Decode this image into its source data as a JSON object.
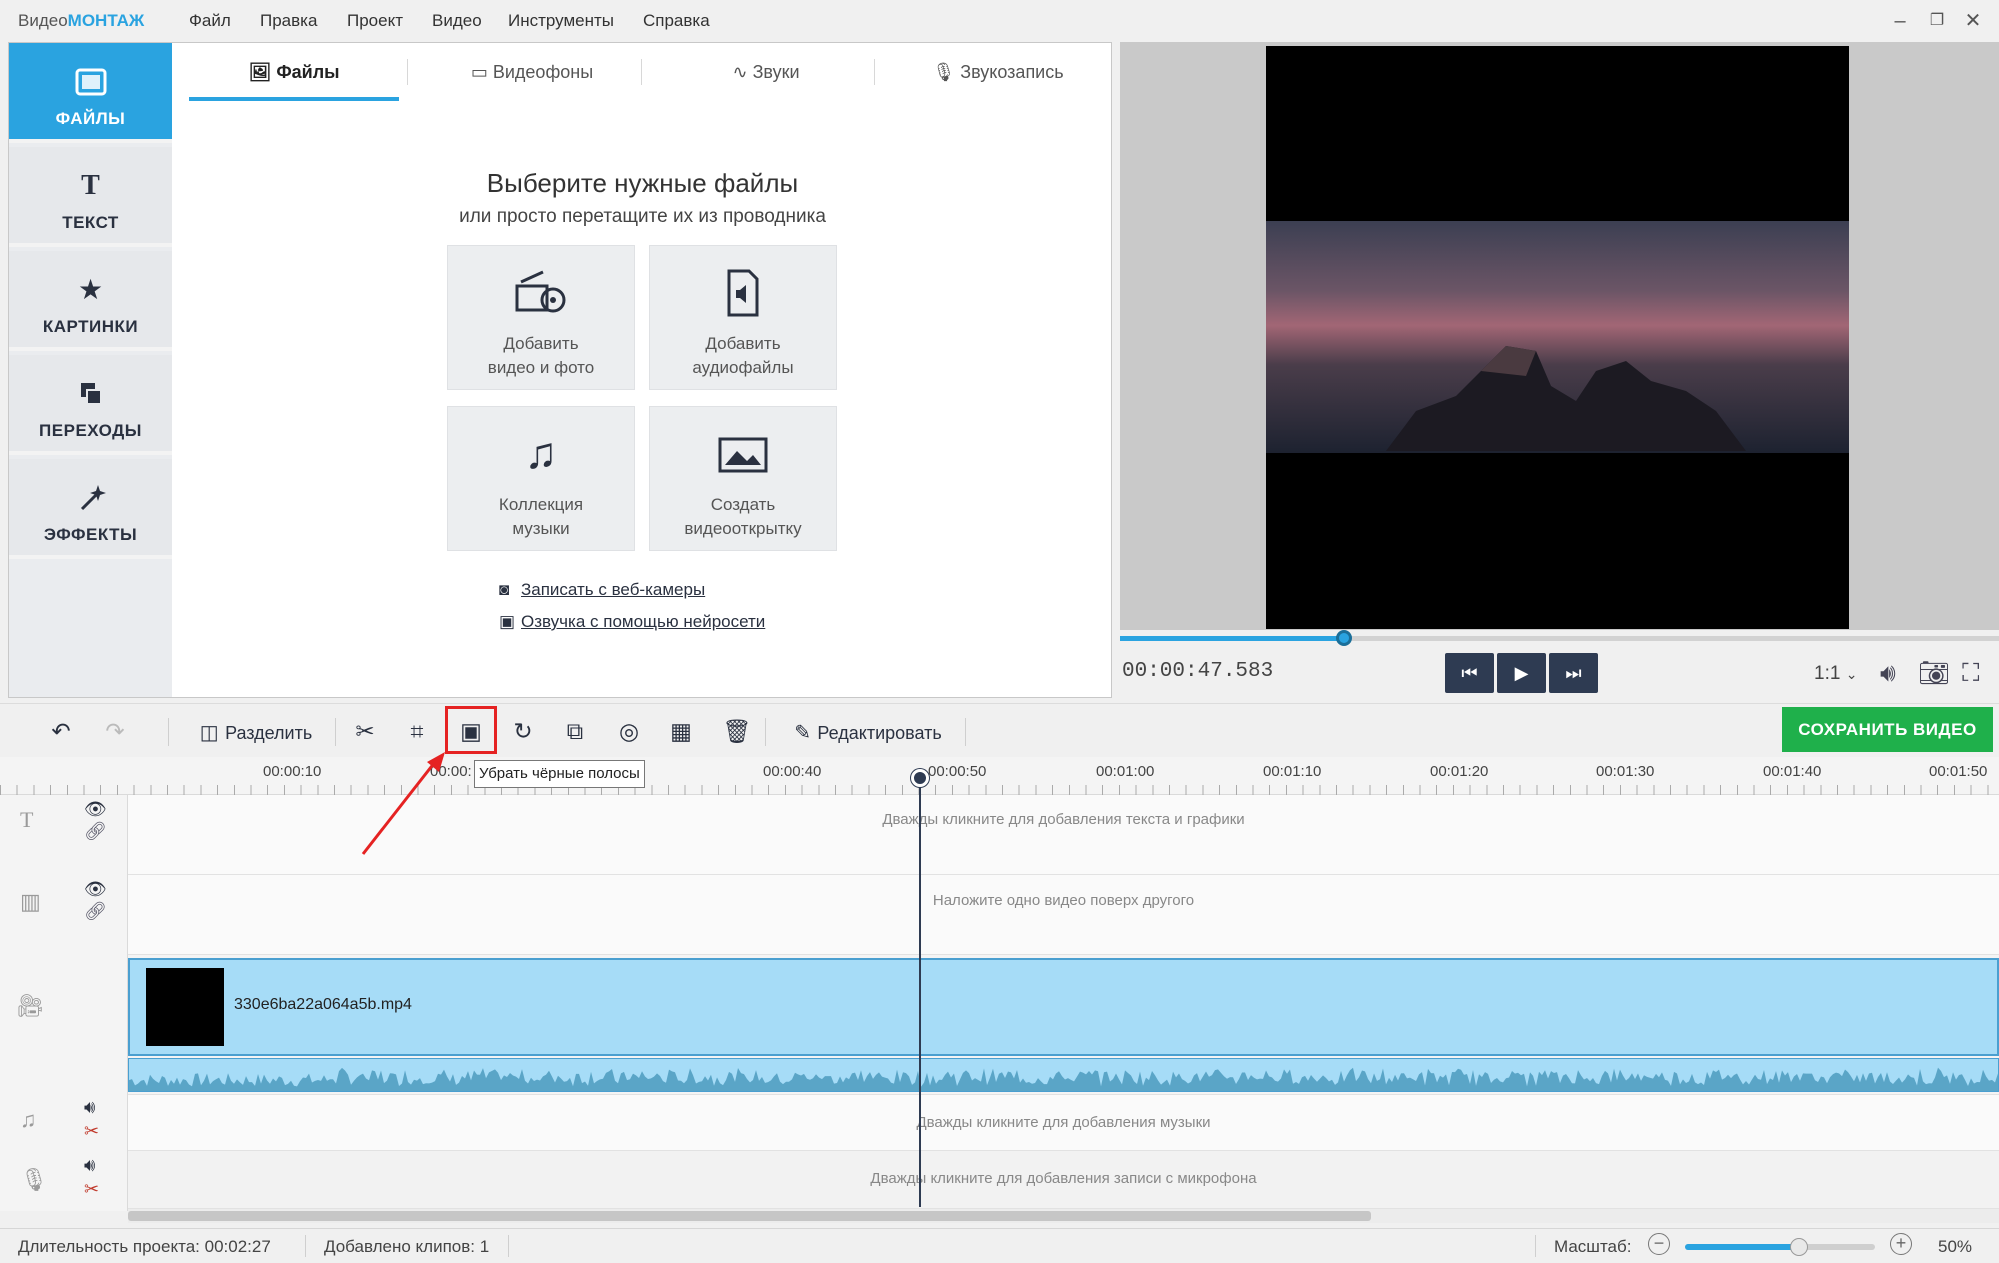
{
  "app": {
    "title_prefix": "Видео",
    "title_brand": "МОНТАЖ"
  },
  "menu": [
    "Файл",
    "Правка",
    "Проект",
    "Видео",
    "Инструменты",
    "Справка"
  ],
  "window_controls": {
    "minimize": "–",
    "restore": "❐",
    "close": "✕"
  },
  "sidebar": [
    {
      "label": "ФАЙЛЫ",
      "icon": "image-icon",
      "active": true
    },
    {
      "label": "ТЕКСТ",
      "icon": "text-icon",
      "active": false
    },
    {
      "label": "КАРТИНКИ",
      "icon": "star-icon",
      "active": false
    },
    {
      "label": "ПЕРЕХОДЫ",
      "icon": "transitions-icon",
      "active": false
    },
    {
      "label": "ЭФФЕКТЫ",
      "icon": "magic-wand-icon",
      "active": false
    }
  ],
  "tabs": [
    {
      "label": "Файлы",
      "icon": "image-icon",
      "active": true
    },
    {
      "label": "Видеофоны",
      "icon": "film-icon",
      "active": false
    },
    {
      "label": "Звуки",
      "icon": "waveform-icon",
      "active": false
    },
    {
      "label": "Звукозапись",
      "icon": "microphone-icon",
      "active": false
    }
  ],
  "files_panel": {
    "heading": "Выберите нужные файлы",
    "subheading": "или просто перетащите их из проводника",
    "tiles": [
      {
        "line1": "Добавить",
        "line2": "видео и фото",
        "icon": "film-camera-icon"
      },
      {
        "line1": "Добавить",
        "line2": "аудиофайлы",
        "icon": "audio-file-icon"
      },
      {
        "line1": "Коллекция",
        "line2": "музыки",
        "icon": "music-notes-icon"
      },
      {
        "line1": "Создать",
        "line2": "видеооткрытку",
        "icon": "postcard-icon"
      }
    ],
    "links": [
      {
        "label": "Записать с веб-камеры",
        "icon": "webcam-icon"
      },
      {
        "label": "Озвучка с помощью нейросети",
        "icon": "ai-voice-icon"
      }
    ]
  },
  "preview": {
    "time": "00:00:47.583",
    "progress": 0.255,
    "ratio": "1:1",
    "controls": [
      "skip-back-icon",
      "play-icon",
      "skip-forward-icon"
    ]
  },
  "toolbar": {
    "split_label": "Разделить",
    "edit_label": "Редактировать",
    "save_label": "СОХРАНИТЬ ВИДЕО",
    "tooltip": "Убрать чёрные полосы"
  },
  "ruler": {
    "labels": [
      "00:00:10",
      "00:00:20",
      "00:00:40",
      "00:00:50",
      "00:01:00",
      "00:01:10",
      "00:01:20",
      "00:01:30",
      "00:01:40",
      "00:01:50"
    ],
    "visible_partial": "00:00:"
  },
  "timeline": {
    "text_track_hint": "Дважды кликните для добавления текста и графики",
    "overlay_track_hint": "Наложите одно видео поверх другого",
    "clip_name": "330e6ba22a064a5b.mp4",
    "music_track_hint": "Дважды кликните для добавления музыки",
    "mic_track_hint": "Дважды кликните для добавления записи с микрофона"
  },
  "status": {
    "duration_label": "Длительность проекта:",
    "duration_value": "00:02:27",
    "clips_label": "Добавлено клипов:",
    "clips_value": "1",
    "zoom_label": "Масштаб:",
    "zoom_value": "50%",
    "zoom_level": 0.6
  },
  "colors": {
    "accent": "#2aa3e0",
    "save_green": "#1fb04b",
    "highlight_red": "#e52222",
    "dark_control": "#2e3b52",
    "clip_blue": "#a6dcf7"
  }
}
